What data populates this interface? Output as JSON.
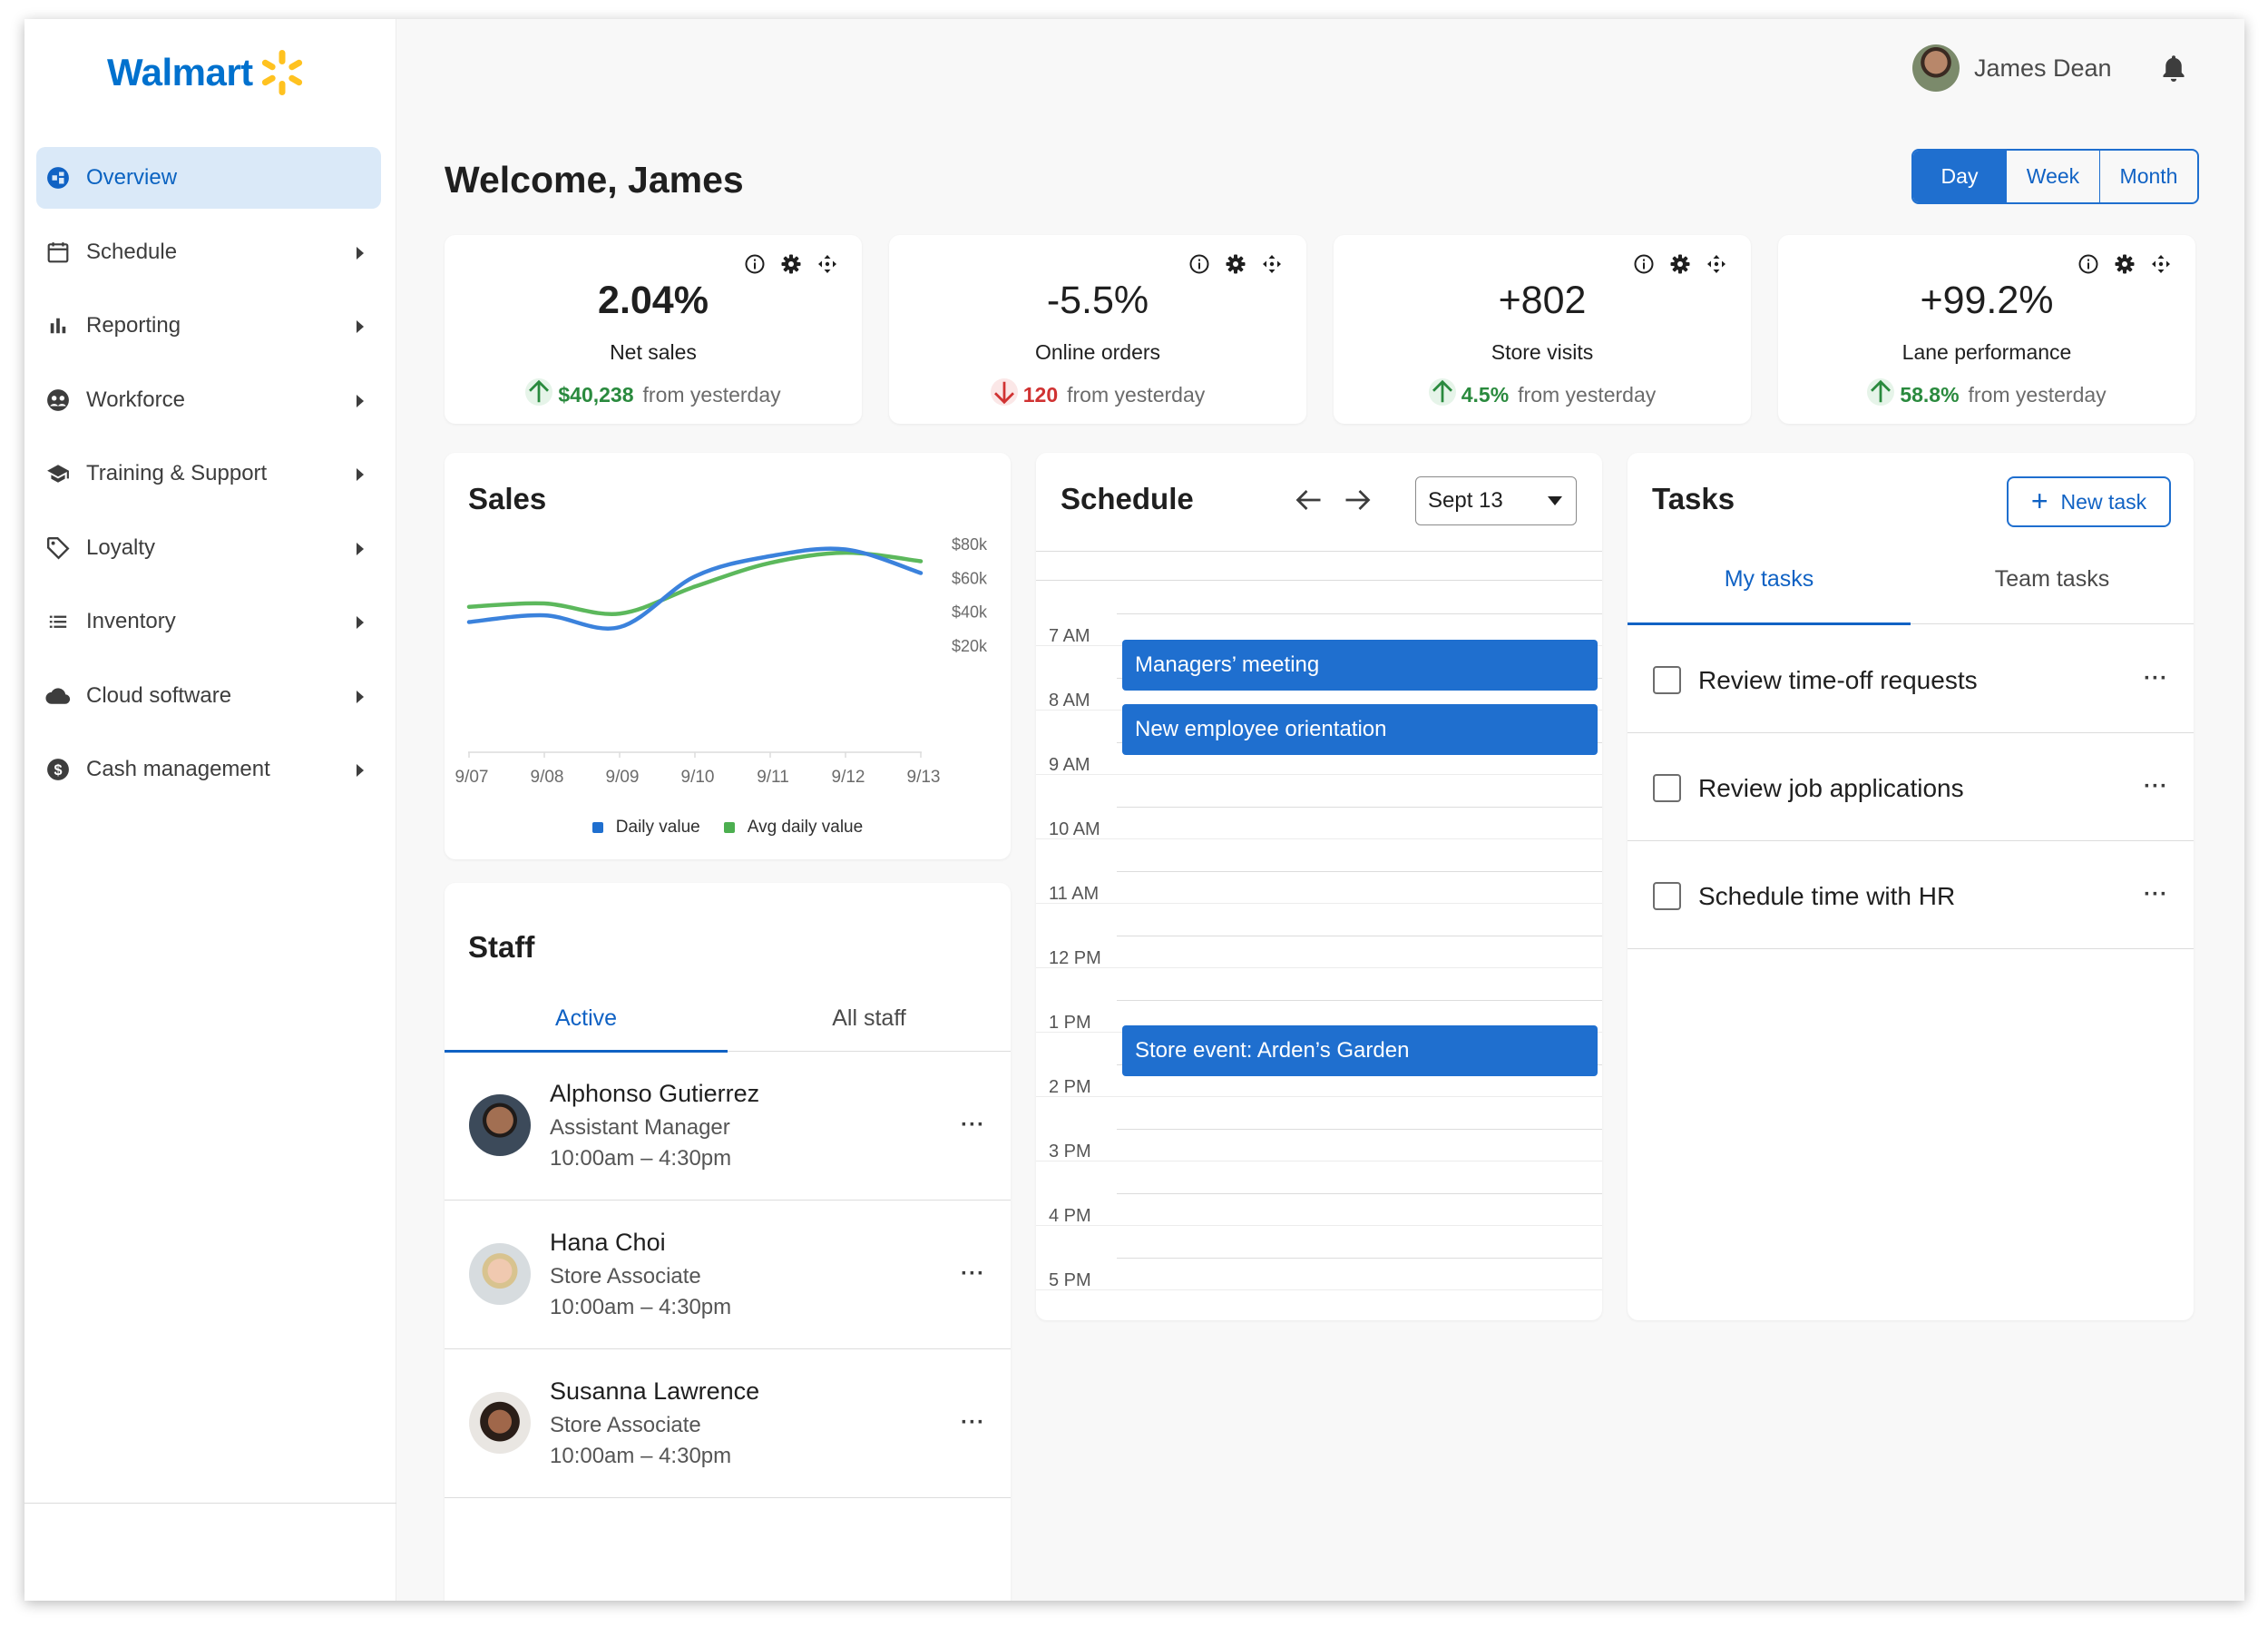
{
  "brand": {
    "name": "Walmart",
    "spark_color": "#ffc220",
    "text_color": "#0071ce"
  },
  "sidebar": {
    "items": [
      {
        "label": "Overview",
        "icon": "overview-icon",
        "active": true
      },
      {
        "label": "Schedule",
        "icon": "calendar-icon"
      },
      {
        "label": "Reporting",
        "icon": "bar-chart-icon"
      },
      {
        "label": "Workforce",
        "icon": "workforce-icon"
      },
      {
        "label": "Training & Support",
        "icon": "graduation-cap-icon"
      },
      {
        "label": "Loyalty",
        "icon": "tag-icon"
      },
      {
        "label": "Inventory",
        "icon": "list-icon"
      },
      {
        "label": "Cloud software",
        "icon": "cloud-icon"
      },
      {
        "label": "Cash management",
        "icon": "dollar-icon"
      }
    ]
  },
  "header": {
    "user_name": "James Dean",
    "welcome": "Welcome, James",
    "range_tabs": [
      "Day",
      "Week",
      "Month"
    ],
    "range_selected": "Day"
  },
  "kpis": [
    {
      "value": "2.04%",
      "label": "Net sales",
      "delta": "$40,238",
      "direction": "up",
      "suffix": "from yesterday"
    },
    {
      "value": "-5.5%",
      "label": "Online orders",
      "delta": "120",
      "direction": "down",
      "suffix": "from yesterday"
    },
    {
      "value": "+802",
      "label": "Store visits",
      "delta": "4.5%",
      "direction": "up",
      "suffix": "from yesterday"
    },
    {
      "value": "+99.2%",
      "label": "Lane performance",
      "delta": "58.8%",
      "direction": "up",
      "suffix": "from yesterday"
    }
  ],
  "sales": {
    "title": "Sales",
    "chart_data": {
      "type": "line",
      "categories": [
        "9/07",
        "9/08",
        "9/09",
        "9/10",
        "9/11",
        "9/12",
        "9/13"
      ],
      "yticks": [
        "$80k",
        "$60k",
        "$40k",
        "$20k"
      ],
      "ylim": [
        0,
        80000
      ],
      "series": [
        {
          "name": "Daily value",
          "color": "#3b82dc",
          "values": [
            33000,
            37000,
            30000,
            60000,
            72000,
            76000,
            62000
          ]
        },
        {
          "name": "Avg daily value",
          "color": "#5cb85c",
          "values": [
            42000,
            44000,
            38000,
            54000,
            68000,
            74000,
            69000
          ]
        }
      ],
      "legend": "bottom",
      "grid": false
    }
  },
  "staff": {
    "title": "Staff",
    "tabs": [
      "Active",
      "All staff"
    ],
    "active_tab": "Active",
    "members": [
      {
        "name": "Alphonso Gutierrez",
        "role": "Assistant Manager",
        "hours": "10:00am – 4:30pm"
      },
      {
        "name": "Hana Choi",
        "role": "Store Associate",
        "hours": "10:00am – 4:30pm"
      },
      {
        "name": "Susanna Lawrence",
        "role": "Store Associate",
        "hours": "10:00am – 4:30pm"
      }
    ]
  },
  "schedule": {
    "title": "Schedule",
    "date": "Sept 13",
    "hours": [
      "7 AM",
      "8 AM",
      "9 AM",
      "10 AM",
      "11 AM",
      "12 PM",
      "1 PM",
      "2 PM",
      "3 PM",
      "4 PM",
      "5 PM"
    ],
    "events": [
      {
        "title": "Managers’ meeting"
      },
      {
        "title": "New employee orientation"
      },
      {
        "title": "Store event: Arden’s Garden"
      }
    ]
  },
  "tasks": {
    "title": "Tasks",
    "new_task_label": "New task",
    "tabs": [
      "My tasks",
      "Team tasks"
    ],
    "active_tab": "My tasks",
    "items": [
      {
        "label": "Review time-off requests",
        "checked": false
      },
      {
        "label": "Review job applications",
        "checked": false
      },
      {
        "label": "Schedule time with HR",
        "checked": false
      }
    ]
  }
}
